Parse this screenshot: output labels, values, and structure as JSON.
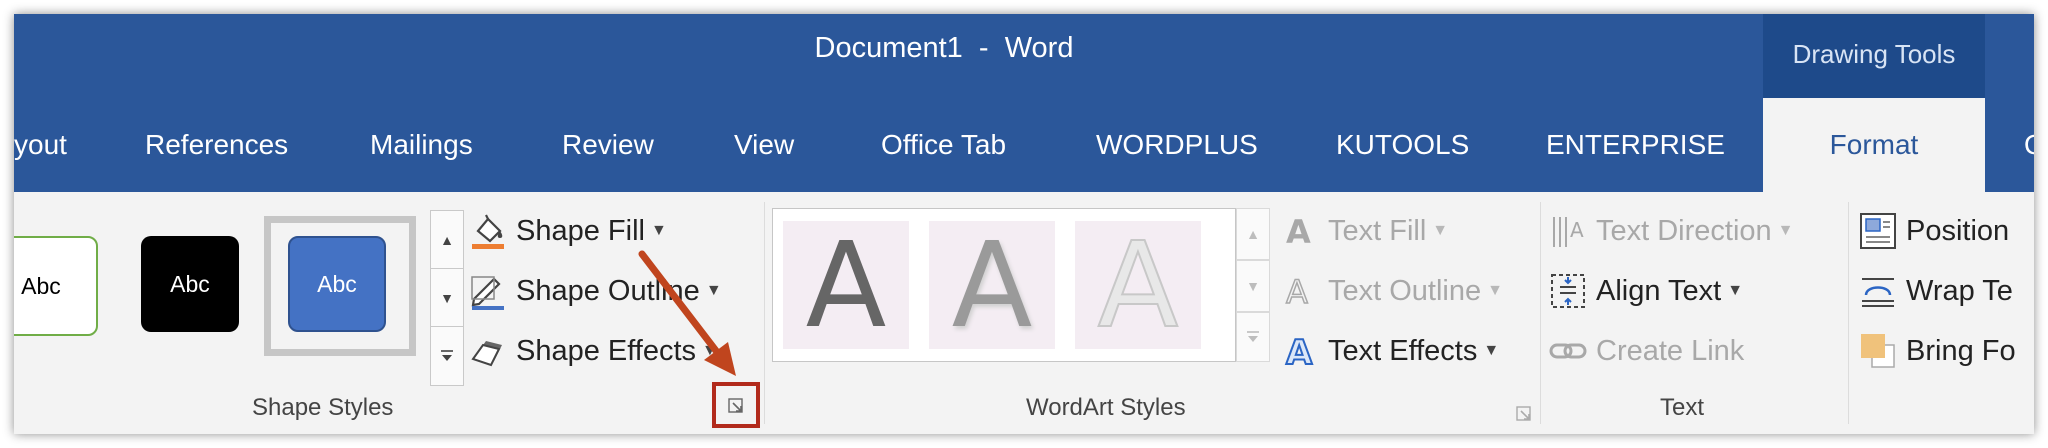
{
  "window": {
    "title": "Document1  -  Word",
    "contextual_tab": "Drawing Tools"
  },
  "tabs": [
    {
      "label": "yout"
    },
    {
      "label": "References"
    },
    {
      "label": "Mailings"
    },
    {
      "label": "Review"
    },
    {
      "label": "View"
    },
    {
      "label": "Office Tab"
    },
    {
      "label": "WORDPLUS"
    },
    {
      "label": "KUTOOLS"
    },
    {
      "label": "ENTERPRISE"
    },
    {
      "label": "Format",
      "active": true
    },
    {
      "label": "Q"
    }
  ],
  "shape_styles": {
    "label": "Shape Styles",
    "gallery": [
      "Abc",
      "Abc",
      "Abc"
    ],
    "commands": {
      "fill": "Shape Fill",
      "outline": "Shape Outline",
      "effects": "Shape Effects"
    }
  },
  "wordart_styles": {
    "label": "WordArt Styles",
    "gallery": [
      "A",
      "A",
      "A"
    ],
    "commands": {
      "fill": "Text Fill",
      "outline": "Text Outline",
      "effects": "Text Effects"
    }
  },
  "text_group": {
    "label": "Text",
    "commands": {
      "direction": "Text Direction",
      "align": "Align Text",
      "link": "Create Link"
    }
  },
  "arrange": {
    "position": "Position",
    "wrap": "Wrap Te",
    "bring": "Bring Fo"
  },
  "colors": {
    "accent": "#2b579a",
    "highlight": "#b22a1c",
    "arrow": "#c0451e"
  }
}
